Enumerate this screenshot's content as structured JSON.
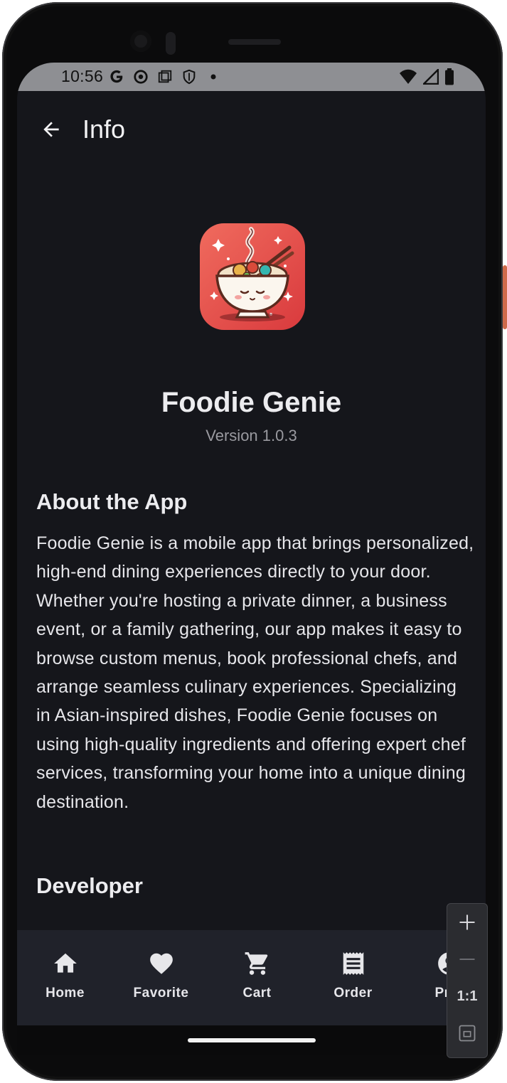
{
  "status_bar": {
    "time": "10:56",
    "left_icons": [
      "google-icon",
      "chrome-icon",
      "screenshot-icon",
      "shield-icon",
      "dot-icon"
    ],
    "right_icons": [
      "wifi-icon",
      "signal-icon",
      "battery-icon"
    ]
  },
  "app_bar": {
    "title": "Info",
    "back_icon": "arrow-left-icon"
  },
  "app_info": {
    "name": "Foodie Genie",
    "version": "Version 1.0.3",
    "logo_icon": "noodle-bowl-logo"
  },
  "about": {
    "title": "About the App",
    "body": "Foodie Genie is a mobile app that brings personalized, high-end dining experiences directly to your door. Whether you're hosting a private dinner, a business event, or a family gathering, our app makes it easy to browse custom menus, book professional chefs, and arrange seamless culinary experiences. Specializing in Asian-inspired dishes, Foodie Genie focuses on using high-quality ingredients and offering expert chef services, transforming your home into a unique dining destination."
  },
  "developer": {
    "title": "Developer"
  },
  "bottom_nav": {
    "items": [
      {
        "label": "Home",
        "icon": "home-icon"
      },
      {
        "label": "Favorite",
        "icon": "heart-icon"
      },
      {
        "label": "Cart",
        "icon": "cart-icon"
      },
      {
        "label": "Order",
        "icon": "receipt-icon"
      },
      {
        "label": "Prof",
        "icon": "profile-icon"
      }
    ]
  },
  "zoom_controls": {
    "plus_icon": "plus-icon",
    "minus_icon": "minus-icon",
    "reset_label": "1:1",
    "fit_icon": "fit-screen-icon"
  },
  "colors": {
    "background": "#15161b",
    "nav_background": "#20222a",
    "text_primary": "#ececef",
    "text_secondary": "#9a9aa0",
    "logo_red": "#e04a48"
  }
}
